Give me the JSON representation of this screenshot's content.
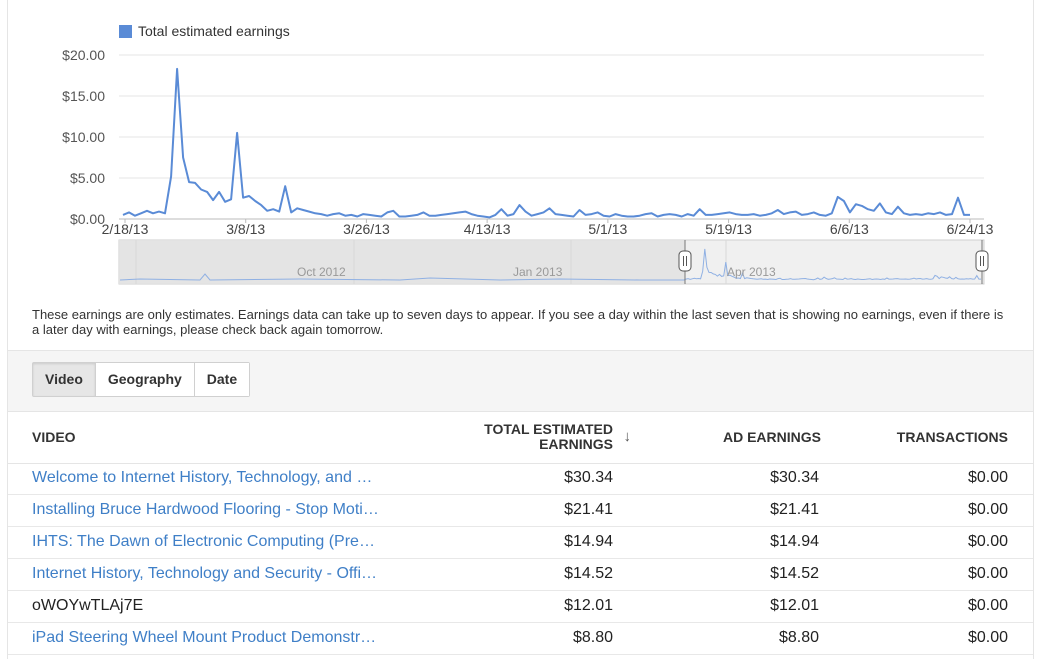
{
  "chart_data": {
    "type": "line",
    "legend": "Total estimated earnings",
    "series": [
      {
        "name": "Total estimated earnings",
        "color": "#5a8bd6",
        "values": [
          0.5,
          0.8,
          0.4,
          0.7,
          1.0,
          0.7,
          0.9,
          0.7,
          5.2,
          18.3,
          7.5,
          4.5,
          4.4,
          3.6,
          3.3,
          2.3,
          3.3,
          2.1,
          2.4,
          10.5,
          2.6,
          2.8,
          2.2,
          1.7,
          1.0,
          1.2,
          0.9,
          4.0,
          0.8,
          1.3,
          1.1,
          0.9,
          0.7,
          0.6,
          0.4,
          0.6,
          0.7,
          0.4,
          0.5,
          0.3,
          0.6,
          0.5,
          0.4,
          0.3,
          0.8,
          1.0,
          0.3,
          0.3,
          0.4,
          0.5,
          0.8,
          0.4,
          0.4,
          0.5,
          0.6,
          0.7,
          0.8,
          0.9,
          0.6,
          0.4,
          0.3,
          0.2,
          0.5,
          1.2,
          0.4,
          0.6,
          1.7,
          0.9,
          0.4,
          0.6,
          0.8,
          1.3,
          0.6,
          0.5,
          0.4,
          0.3,
          1.1,
          0.5,
          0.6,
          0.8,
          0.4,
          0.3,
          0.6,
          0.4,
          0.3,
          0.3,
          0.4,
          0.6,
          0.7,
          0.3,
          0.5,
          0.6,
          0.5,
          0.3,
          0.6,
          0.4,
          1.2,
          0.5,
          0.5,
          0.6,
          0.7,
          0.8,
          0.6,
          0.5,
          0.5,
          0.6,
          0.4,
          0.5,
          0.7,
          1.1,
          0.6,
          0.8,
          0.9,
          0.5,
          0.6,
          0.8,
          0.5,
          0.4,
          0.7,
          2.7,
          2.2,
          0.8,
          1.8,
          1.6,
          1.2,
          1.0,
          1.9,
          0.8,
          0.6,
          1.5,
          0.7,
          0.5,
          0.6,
          0.5,
          0.7,
          0.6,
          0.8,
          0.5,
          0.6,
          2.6,
          0.5,
          0.5
        ]
      }
    ],
    "y_ticks": [
      "$20.00",
      "$15.00",
      "$10.00",
      "$5.00",
      "$0.00"
    ],
    "ylim": [
      0,
      20
    ],
    "x_ticks": [
      "2/18/13",
      "3/8/13",
      "3/26/13",
      "4/13/13",
      "5/1/13",
      "5/19/13",
      "6/6/13",
      "6/24/13"
    ],
    "navigator_labels": [
      "Oct 2012",
      "Jan 2013",
      "Apr 2013"
    ]
  },
  "disclaimer": "These earnings are only estimates. Earnings data can take up to seven days to appear. If you see a day within the last seven that is showing no earnings, even if there is a later day with earnings, please check back again tomorrow.",
  "tabs": [
    {
      "label": "Video",
      "active": true
    },
    {
      "label": "Geography",
      "active": false
    },
    {
      "label": "Date",
      "active": false
    }
  ],
  "table": {
    "headers": {
      "video": "VIDEO",
      "total_line1": "TOTAL ESTIMATED",
      "total_line2": "EARNINGS",
      "ad": "AD EARNINGS",
      "transactions": "TRANSACTIONS"
    },
    "sort_icon": "arrow-down-icon",
    "rows": [
      {
        "video": "Welcome to Internet History, Technology, and …",
        "total": "$30.34",
        "ad": "$30.34",
        "transactions": "$0.00",
        "link": true
      },
      {
        "video": "Installing Bruce Hardwood Flooring - Stop Moti…",
        "total": "$21.41",
        "ad": "$21.41",
        "transactions": "$0.00",
        "link": true
      },
      {
        "video": "IHTS: The Dawn of Electronic Computing (Pre…",
        "total": "$14.94",
        "ad": "$14.94",
        "transactions": "$0.00",
        "link": true
      },
      {
        "video": "Internet History, Technology and Security - Offi…",
        "total": "$14.52",
        "ad": "$14.52",
        "transactions": "$0.00",
        "link": true
      },
      {
        "video": "oWOYwTLAj7E",
        "total": "$12.01",
        "ad": "$12.01",
        "transactions": "$0.00",
        "link": false
      },
      {
        "video": "iPad Steering Wheel Mount Product Demonstr…",
        "total": "$8.80",
        "ad": "$8.80",
        "transactions": "$0.00",
        "link": true
      }
    ]
  }
}
